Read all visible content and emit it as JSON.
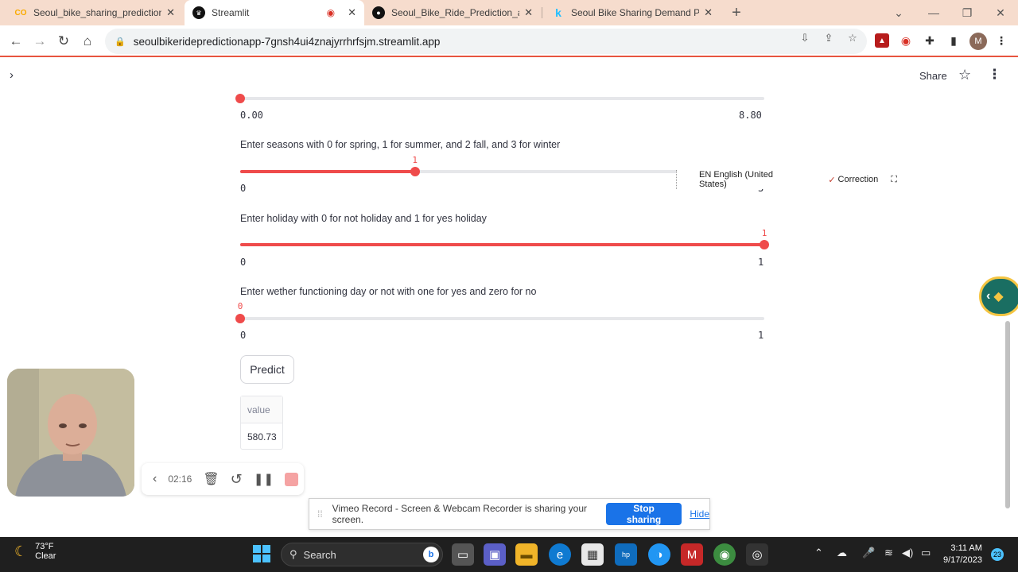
{
  "browser": {
    "tabs": [
      {
        "title": "Seoul_bike_sharing_prediction.ip",
        "favicon": "CO"
      },
      {
        "title": "Streamlit",
        "favicon": "streamlit-logo"
      },
      {
        "title": "Seoul_Bike_Ride_Prediction_app/",
        "favicon": "github-logo"
      },
      {
        "title": "Seoul Bike Sharing Demand Pred",
        "favicon": "k"
      }
    ],
    "url": "seoulbikeridepredictionapp-7gnsh4ui4znajyrrhrfsjm.streamlit.app",
    "avatar_initial": "M"
  },
  "app": {
    "share_label": "Share",
    "slider_top": {
      "value": 0,
      "min_label": "0.00",
      "max_label": "8.80"
    },
    "seasons": {
      "label": "Enter seasons with 0 for spring, 1 for summer, and 2 fall, and 3 for winter",
      "value": 1,
      "value_label": "1",
      "min": 0,
      "max": 3,
      "min_label": "0",
      "max_label": "3"
    },
    "holiday": {
      "label": "Enter holiday with 0 for not holiday and 1 for yes holiday",
      "value": 1,
      "value_label": "1",
      "min": 0,
      "max": 1,
      "min_label": "0",
      "max_label": "1"
    },
    "functioning": {
      "label": "Enter wether functioning day or not with one for yes and zero for no",
      "value": 0,
      "value_label": "0",
      "min": 0,
      "max": 1,
      "min_label": "0",
      "max_label": "1"
    },
    "predict_label": "Predict",
    "result": {
      "header": "value",
      "cell": "580.73"
    }
  },
  "ime": {
    "language": "EN English (United States)",
    "correction": "Correction"
  },
  "recorder": {
    "time": "02:16"
  },
  "share_banner": {
    "message": "Vimeo Record - Screen & Webcam Recorder is sharing your screen.",
    "stop": "Stop sharing",
    "hide": "Hide"
  },
  "taskbar": {
    "temp": "73°F",
    "condition": "Clear",
    "search": "Search",
    "time": "3:11 AM",
    "date": "9/17/2023",
    "notifications": "23"
  },
  "colors": {
    "accent": "#ef4b4b",
    "tabstrip": "#f6dccd",
    "stop_button": "#1a73e8"
  }
}
